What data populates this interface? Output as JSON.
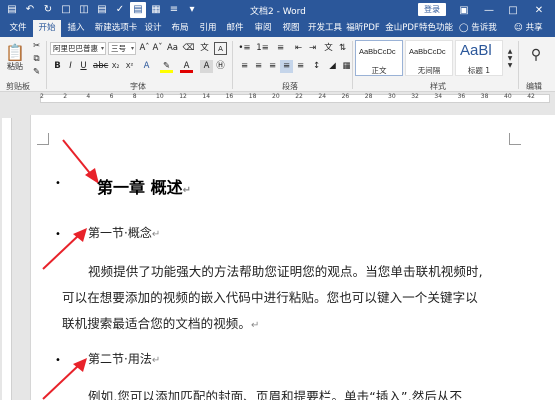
{
  "window": {
    "title": "文档2 - Word",
    "login_label": "登录"
  },
  "tabs": [
    {
      "label": "文件"
    },
    {
      "label": "开始"
    },
    {
      "label": "插入"
    },
    {
      "label": "新建选项卡"
    },
    {
      "label": "设计"
    },
    {
      "label": "布局"
    },
    {
      "label": "引用"
    },
    {
      "label": "邮件"
    },
    {
      "label": "审阅"
    },
    {
      "label": "视图"
    },
    {
      "label": "开发工具"
    },
    {
      "label": "福昕PDF"
    },
    {
      "label": "金山PDF"
    },
    {
      "label": "特色功能"
    }
  ],
  "tell_me": "告诉我",
  "share": "共享",
  "ribbon": {
    "clipboard": {
      "paste": "粘贴",
      "label": "剪贴板"
    },
    "font": {
      "name": "阿里巴巴普惠",
      "size": "三号",
      "label": "字体"
    },
    "paragraph": {
      "label": "段落"
    },
    "styles": {
      "label": "样式",
      "items": [
        {
          "sample": "AaBbCcDc",
          "name": "正文"
        },
        {
          "sample": "AaBbCcDc",
          "name": "无间隔"
        },
        {
          "sample": "AaBl",
          "name": "标题 1"
        }
      ]
    },
    "editing": {
      "label": "编辑"
    }
  },
  "ruler": {
    "numbers": [
      "2",
      "2",
      "4",
      "6",
      "8",
      "10",
      "12",
      "14",
      "16",
      "18",
      "20",
      "22",
      "24",
      "26",
      "28",
      "30",
      "32",
      "34",
      "36",
      "38",
      "40",
      "42"
    ]
  },
  "document": {
    "heading1": "第一章 概述",
    "section1_title": "第一节·概念",
    "para1_line1": "视频提供了功能强大的方法帮助您证明您的观点。当您单击联机视频时,",
    "para1_line2": "可以在想要添加的视频的嵌入代码中进行粘贴。您也可以键入一个关键字以",
    "para1_line3": "联机搜索最适合您的文档的视频。",
    "section2_title": "第二节·用法",
    "para2_line1": "例如,您可以添加匹配的封面、页眉和提要栏。单击“插入”,然后从不"
  }
}
